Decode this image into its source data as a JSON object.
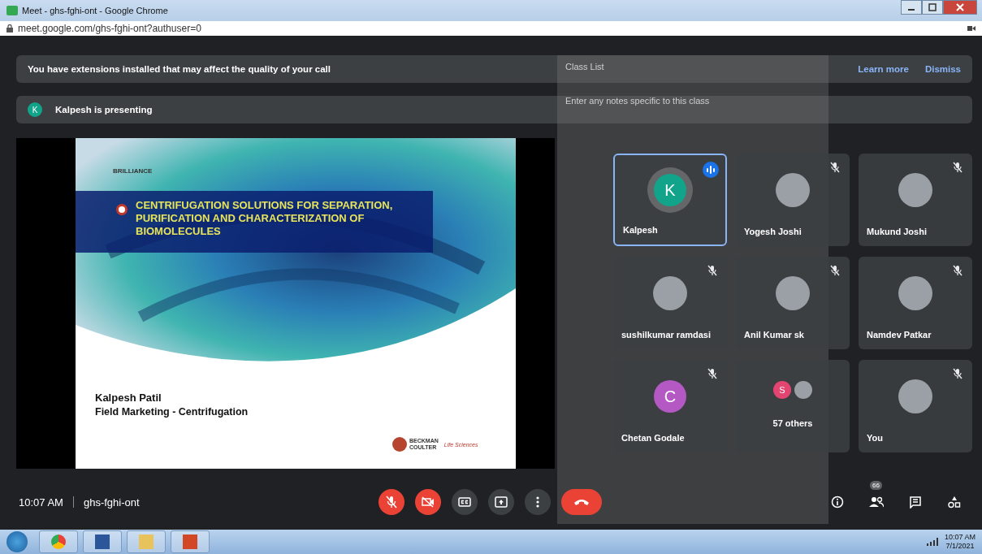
{
  "window": {
    "title": "Meet - ghs-fghi-ont - Google Chrome"
  },
  "address_bar": {
    "url": "meet.google.com/ghs-fghi-ont?authuser=0"
  },
  "extension_banner": {
    "message": "You have extensions installed that may affect the quality of your call",
    "actions": [
      "Learn more",
      "Dismiss"
    ]
  },
  "presenting_banner": {
    "initial": "K",
    "text": "Kalpesh is presenting"
  },
  "slide": {
    "brand": "BRILLIANCE",
    "title": "CENTRIFUGATION SOLUTIONS FOR SEPARATION, PURIFICATION AND CHARACTERIZATION OF BIOMOLECULES",
    "presenter": "Kalpesh Patil",
    "role": "Field Marketing - Centrifugation",
    "logo_lines": [
      "BECKMAN",
      "COULTER"
    ],
    "logo_tag": "Life Sciences"
  },
  "class_list_panel": {
    "title": "Class List",
    "notes_placeholder": "Enter any notes specific to this class"
  },
  "tiles": [
    {
      "kind": "avatar",
      "name": "Kalpesh",
      "initial": "K",
      "color": "#12a38b",
      "speaking": true,
      "muted": false
    },
    {
      "kind": "photo",
      "name": "Yogesh Joshi",
      "speaking": false,
      "muted": true
    },
    {
      "kind": "photo",
      "name": "Mukund Joshi",
      "speaking": false,
      "muted": true
    },
    {
      "kind": "photo",
      "name": "sushilkumar ramdasi",
      "speaking": false,
      "muted": true
    },
    {
      "kind": "photo",
      "name": "Anil Kumar sk",
      "speaking": false,
      "muted": true
    },
    {
      "kind": "photo",
      "name": "Namdev Patkar",
      "speaking": false,
      "muted": true
    },
    {
      "kind": "avatar",
      "name": "Chetan Godale",
      "initial": "C",
      "color": "#b459c4",
      "speaking": false,
      "muted": true
    },
    {
      "kind": "others",
      "name": "57 others",
      "initial": "S",
      "color": "#e2456f",
      "speaking": false,
      "muted": false
    },
    {
      "kind": "photo",
      "name": "You",
      "speaking": false,
      "muted": true
    }
  ],
  "bottom_bar": {
    "time": "10:07 AM",
    "meeting_code": "ghs-fghi-ont",
    "controls": [
      {
        "kind": "mic",
        "off": true
      },
      {
        "kind": "camera",
        "off": true
      },
      {
        "kind": "captions"
      },
      {
        "kind": "present"
      },
      {
        "kind": "more"
      },
      {
        "kind": "hangup"
      }
    ],
    "people_count": "66"
  },
  "taskbar": {
    "time": "10:07 AM",
    "date": "7/1/2021"
  }
}
